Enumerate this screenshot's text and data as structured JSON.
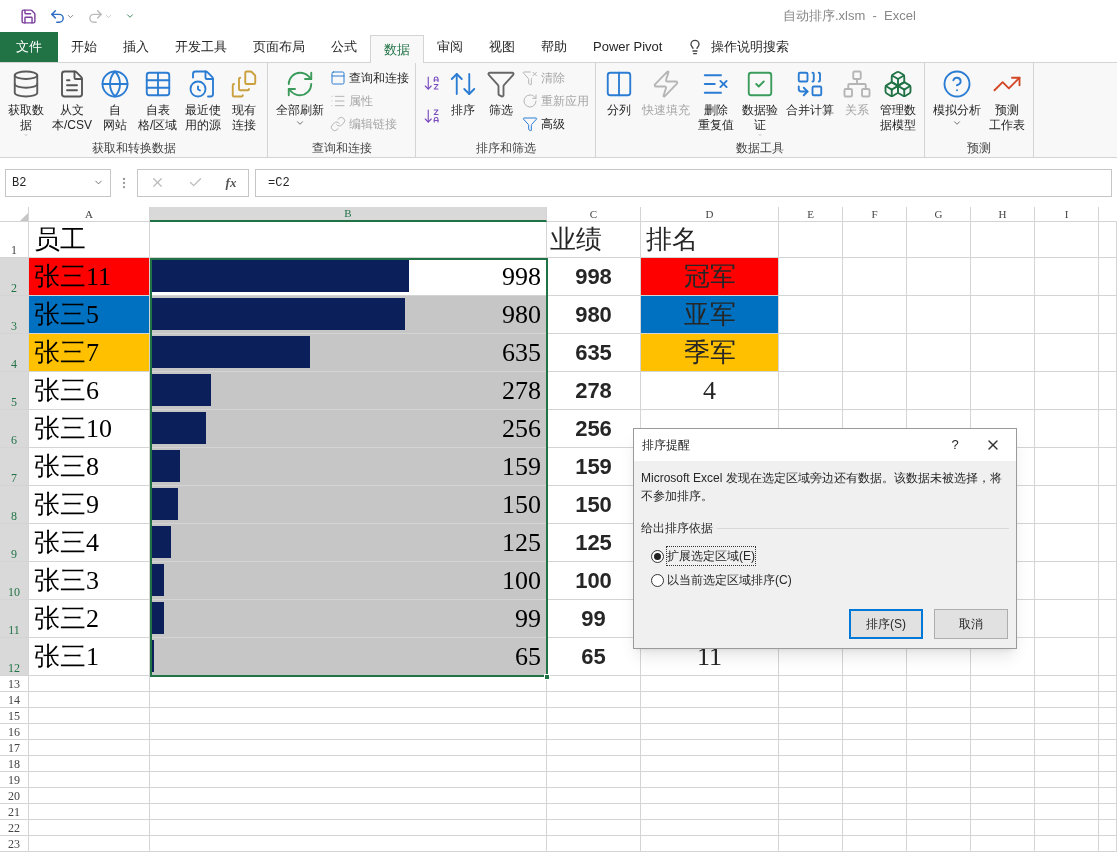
{
  "window": {
    "title": "自动排序.xlsm  -  Excel"
  },
  "tabs": [
    {
      "label": "文件",
      "kind": "file",
      "selected": false
    },
    {
      "label": "开始",
      "kind": "tab",
      "selected": false
    },
    {
      "label": "插入",
      "kind": "tab",
      "selected": false
    },
    {
      "label": "开发工具",
      "kind": "tab",
      "selected": false
    },
    {
      "label": "页面布局",
      "kind": "tab",
      "selected": false
    },
    {
      "label": "公式",
      "kind": "tab",
      "selected": false
    },
    {
      "label": "数据",
      "kind": "tab",
      "selected": true
    },
    {
      "label": "审阅",
      "kind": "tab",
      "selected": false
    },
    {
      "label": "视图",
      "kind": "tab",
      "selected": false
    },
    {
      "label": "帮助",
      "kind": "tab",
      "selected": false
    },
    {
      "label": "Power Pivot",
      "kind": "tab",
      "selected": false
    }
  ],
  "tell_me": "操作说明搜索",
  "ribbon_groups": [
    {
      "label": "获取和转换数据",
      "items": [
        {
          "kind": "large",
          "lines": [
            "获取数",
            "据"
          ],
          "dropdown": true,
          "disabled": false
        },
        {
          "kind": "large",
          "lines": [
            "从文",
            "本/CSV"
          ],
          "dropdown": false,
          "disabled": false
        },
        {
          "kind": "large",
          "lines": [
            "自",
            "网站"
          ],
          "dropdown": false,
          "disabled": false
        },
        {
          "kind": "large",
          "lines": [
            "自表",
            "格/区域"
          ],
          "dropdown": false,
          "disabled": false
        },
        {
          "kind": "large",
          "lines": [
            "最近使",
            "用的源"
          ],
          "dropdown": false,
          "disabled": false
        },
        {
          "kind": "large",
          "lines": [
            "现有",
            "连接"
          ],
          "dropdown": false,
          "disabled": false
        }
      ]
    },
    {
      "label": "查询和连接",
      "items": [
        {
          "kind": "large",
          "lines": [
            "全部刷新"
          ],
          "dropdown": true,
          "disabled": false
        },
        {
          "kind": "stack",
          "items": [
            {
              "kind": "small",
              "label": "查询和连接",
              "disabled": false
            },
            {
              "kind": "small",
              "label": "属性",
              "disabled": true
            },
            {
              "kind": "small",
              "label": "编辑链接",
              "disabled": true
            }
          ]
        }
      ]
    },
    {
      "label": "排序和筛选",
      "items": [
        {
          "kind": "stack",
          "items": [
            {
              "kind": "icon",
              "disabled": false
            },
            {
              "kind": "icon",
              "disabled": false
            }
          ]
        },
        {
          "kind": "large",
          "lines": [
            "排序"
          ],
          "dropdown": false,
          "disabled": false
        },
        {
          "kind": "large",
          "lines": [
            "筛选"
          ],
          "dropdown": false,
          "disabled": false
        },
        {
          "kind": "stack",
          "items": [
            {
              "kind": "small",
              "label": "清除",
              "disabled": true
            },
            {
              "kind": "small",
              "label": "重新应用",
              "disabled": true
            },
            {
              "kind": "small",
              "label": "高级",
              "disabled": false
            }
          ]
        }
      ]
    },
    {
      "label": "数据工具",
      "items": [
        {
          "kind": "large",
          "lines": [
            "分列"
          ],
          "dropdown": false,
          "disabled": false
        },
        {
          "kind": "large",
          "lines": [
            "快速填充"
          ],
          "dropdown": false,
          "disabled": true
        },
        {
          "kind": "large",
          "lines": [
            "删除",
            "重复值"
          ],
          "dropdown": false,
          "disabled": false
        },
        {
          "kind": "large",
          "lines": [
            "数据验",
            "证"
          ],
          "dropdown": true,
          "disabled": false
        },
        {
          "kind": "large",
          "lines": [
            "合并计算"
          ],
          "dropdown": false,
          "disabled": false
        },
        {
          "kind": "large",
          "lines": [
            "关系"
          ],
          "dropdown": false,
          "disabled": true
        },
        {
          "kind": "large",
          "lines": [
            "管理数",
            "据模型"
          ],
          "dropdown": false,
          "disabled": false
        }
      ]
    },
    {
      "label": "预测",
      "items": [
        {
          "kind": "large",
          "lines": [
            "模拟分析"
          ],
          "dropdown": true,
          "disabled": false
        },
        {
          "kind": "large",
          "lines": [
            "预测",
            "工作表"
          ],
          "dropdown": false,
          "disabled": false
        }
      ]
    }
  ],
  "formula_bar": {
    "name_box": "B2",
    "function_button": "fx",
    "formula": "=C2"
  },
  "columns": [
    {
      "label": "A",
      "selected": false
    },
    {
      "label": "B",
      "selected": true
    },
    {
      "label": "C",
      "selected": false
    },
    {
      "label": "D",
      "selected": false
    },
    {
      "label": "E",
      "selected": false
    },
    {
      "label": "F",
      "selected": false
    },
    {
      "label": "G",
      "selected": false
    },
    {
      "label": "H",
      "selected": false
    },
    {
      "label": "I",
      "selected": false
    }
  ],
  "rows": [
    {
      "number": "1",
      "kind": "header",
      "selected": false,
      "employee": {
        "text": "员工"
      },
      "score": "业绩",
      "rank": {
        "text": "排名"
      }
    },
    {
      "number": "2",
      "kind": "data",
      "selected": true,
      "employee": {
        "text": "张三11",
        "color": "#ff0000"
      },
      "bar": {
        "text": "998",
        "level": 0.65,
        "active": true
      },
      "score": "998",
      "rank": {
        "text": "冠军",
        "color": "#ff0000"
      }
    },
    {
      "number": "3",
      "kind": "data",
      "selected": true,
      "employee": {
        "text": "张三5",
        "color": "#0070c0"
      },
      "bar": {
        "text": "980",
        "level": 0.64,
        "active": false
      },
      "score": "980",
      "rank": {
        "text": "亚军",
        "color": "#0070c0"
      }
    },
    {
      "number": "4",
      "kind": "data",
      "selected": true,
      "employee": {
        "text": "张三7",
        "color": "#ffc000"
      },
      "bar": {
        "text": "635",
        "level": 0.4,
        "active": false
      },
      "score": "635",
      "rank": {
        "text": "季军",
        "color": "#ffc000"
      }
    },
    {
      "number": "5",
      "kind": "data",
      "selected": true,
      "employee": {
        "text": "张三6"
      },
      "bar": {
        "text": "278",
        "level": 0.15,
        "active": false
      },
      "score": "278",
      "rank": {
        "text": "4"
      }
    },
    {
      "number": "6",
      "kind": "data",
      "selected": true,
      "employee": {
        "text": "张三10"
      },
      "bar": {
        "text": "256",
        "level": 0.137,
        "active": false
      },
      "score": "256"
    },
    {
      "number": "7",
      "kind": "data",
      "selected": true,
      "employee": {
        "text": "张三8"
      },
      "bar": {
        "text": "159",
        "level": 0.07,
        "active": false
      },
      "score": "159"
    },
    {
      "number": "8",
      "kind": "data",
      "selected": true,
      "employee": {
        "text": "张三9"
      },
      "bar": {
        "text": "150",
        "level": 0.066,
        "active": false
      },
      "score": "150"
    },
    {
      "number": "9",
      "kind": "data",
      "selected": true,
      "employee": {
        "text": "张三4"
      },
      "bar": {
        "text": "125",
        "level": 0.048,
        "active": false
      },
      "score": "125"
    },
    {
      "number": "10",
      "kind": "data",
      "selected": true,
      "employee": {
        "text": "张三3"
      },
      "bar": {
        "text": "100",
        "level": 0.03,
        "active": false
      },
      "score": "100"
    },
    {
      "number": "11",
      "kind": "data",
      "selected": true,
      "employee": {
        "text": "张三2"
      },
      "bar": {
        "text": "99",
        "level": 0.03,
        "active": false
      },
      "score": "99"
    },
    {
      "number": "12",
      "kind": "data",
      "selected": true,
      "employee": {
        "text": "张三1"
      },
      "bar": {
        "text": "65",
        "level": 0.005,
        "active": false
      },
      "score": "65",
      "rank": {
        "text": "11"
      }
    },
    {
      "number": "13",
      "kind": "empty",
      "selected": false
    },
    {
      "number": "14",
      "kind": "empty",
      "selected": false
    },
    {
      "number": "15",
      "kind": "empty",
      "selected": false
    },
    {
      "number": "16",
      "kind": "empty",
      "selected": false
    },
    {
      "number": "17",
      "kind": "empty",
      "selected": false
    },
    {
      "number": "18",
      "kind": "empty",
      "selected": false
    },
    {
      "number": "19",
      "kind": "empty",
      "selected": false
    },
    {
      "number": "20",
      "kind": "empty",
      "selected": false
    },
    {
      "number": "21",
      "kind": "empty",
      "selected": false
    },
    {
      "number": "22",
      "kind": "empty",
      "selected": false
    },
    {
      "number": "23",
      "kind": "empty",
      "selected": false
    }
  ],
  "dialog": {
    "title": "排序提醒",
    "help": "?",
    "message": "Microsoft Excel 发现在选定区域旁边还有数据。该数据未被选择，将不参加排序。",
    "section": "给出排序依据",
    "options": [
      {
        "label": "扩展选定区域(E)",
        "selected": true
      },
      {
        "label": "以当前选定区域排序(C)",
        "selected": false
      }
    ],
    "buttons": [
      {
        "label": "排序(S)",
        "default": true
      },
      {
        "label": "取消",
        "default": false
      }
    ]
  }
}
